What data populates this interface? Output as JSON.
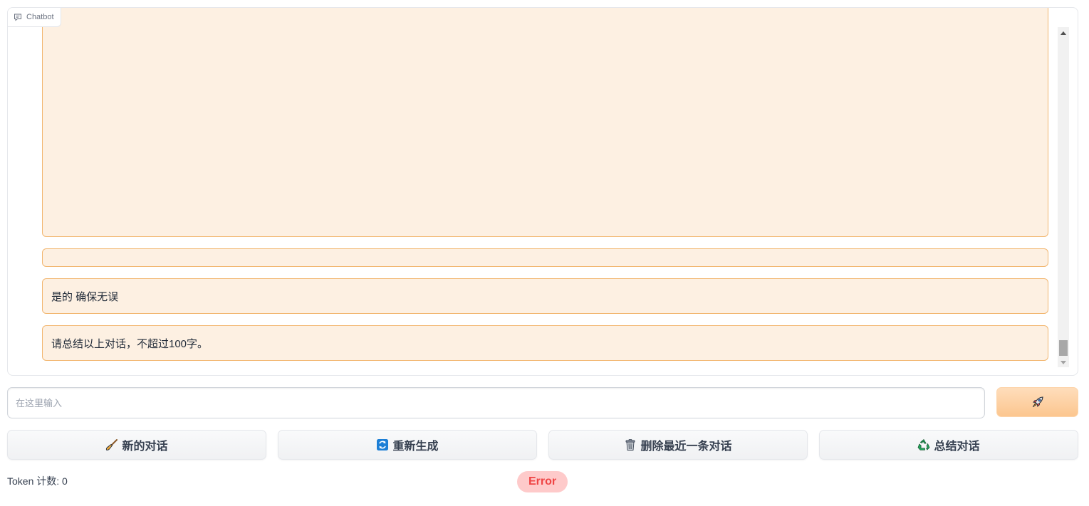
{
  "chatbot": {
    "label": "Chatbot",
    "messages": [
      {
        "text": ""
      },
      {
        "text": ""
      },
      {
        "text": "是的 确保无误"
      },
      {
        "text": "请总结以上对话，不超过100字。"
      }
    ]
  },
  "input": {
    "placeholder": "在这里输入",
    "value": ""
  },
  "send_button": {
    "icon": "rocket-icon"
  },
  "actions": [
    {
      "icon": "broom-icon",
      "label": "新的对话"
    },
    {
      "icon": "refresh-icon",
      "label": "重新生成"
    },
    {
      "icon": "trash-icon",
      "label": "删除最近一条对话"
    },
    {
      "icon": "recycle-icon",
      "label": "总结对话"
    }
  ],
  "status": {
    "token_count": "Token 计数: 0",
    "error": "Error"
  },
  "colors": {
    "message_bg": "#fdf0e2",
    "message_border": "#f2b66f",
    "send_button": "#fcc68f",
    "error_bg": "#fecaca",
    "error_text": "#ef4444"
  }
}
